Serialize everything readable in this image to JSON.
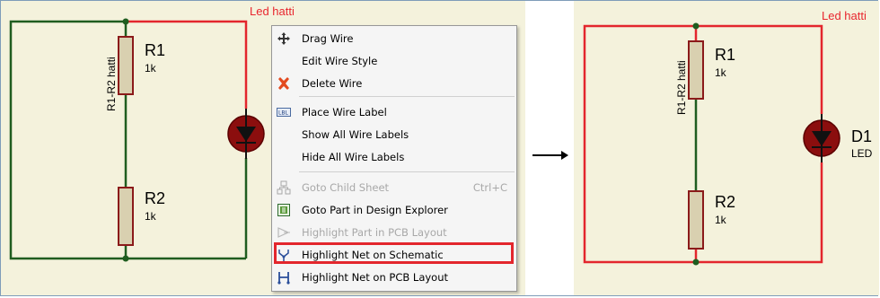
{
  "left_schematic": {
    "net_label": "Led hatti",
    "wire_label": "R1-R2 hatti",
    "r1": {
      "ref": "R1",
      "value": "1k"
    },
    "r2": {
      "ref": "R2",
      "value": "1k"
    }
  },
  "right_schematic": {
    "net_label": "Led hatti",
    "wire_label": "R1-R2 hatti",
    "r1": {
      "ref": "R1",
      "value": "1k"
    },
    "r2": {
      "ref": "R2",
      "value": "1k"
    },
    "d1": {
      "ref": "D1",
      "value": "LED"
    }
  },
  "context_menu": {
    "items": [
      {
        "label": "Drag Wire",
        "icon": "move-icon"
      },
      {
        "label": "Edit Wire Style",
        "icon": ""
      },
      {
        "label": "Delete Wire",
        "icon": "delete-x-icon"
      },
      {
        "label": "Place Wire Label",
        "icon": "label-icon"
      },
      {
        "label": "Show All Wire Labels",
        "icon": ""
      },
      {
        "label": "Hide All Wire Labels",
        "icon": ""
      },
      {
        "label": "Goto Child Sheet",
        "shortcut": "Ctrl+C",
        "icon": "child-sheet-icon",
        "disabled": true
      },
      {
        "label": "Goto Part in Design Explorer",
        "icon": "design-explorer-icon"
      },
      {
        "label": "Highlight Part in PCB Layout",
        "icon": "pcb-part-icon",
        "disabled": true
      },
      {
        "label": "Highlight Net on Schematic",
        "icon": "net-schematic-icon",
        "highlighted": true
      },
      {
        "label": "Highlight Net on PCB Layout",
        "icon": "net-pcb-icon"
      }
    ]
  },
  "colors": {
    "panel_bg": "#f4f2dc",
    "wire_green": "#1f5d1f",
    "net_red": "#e3262d",
    "resistor_fill": "#d9d0b0",
    "resistor_stroke": "#8b1a1a",
    "led_fill": "#8b0e0e"
  }
}
